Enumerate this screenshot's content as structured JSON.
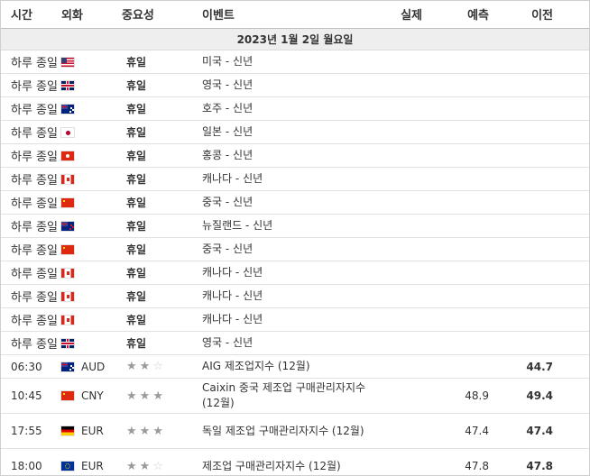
{
  "header": {
    "time": "시간",
    "currency": "외화",
    "importance": "중요성",
    "event": "이벤트",
    "actual": "실제",
    "forecast": "예측",
    "previous": "이전"
  },
  "date_row": "2023년 1월 2일 월요일",
  "holiday_rows": [
    {
      "time": "하루 종일",
      "flag": "us-flag-icon",
      "importance": "휴일",
      "event": "미국 - 신년"
    },
    {
      "time": "하루 종일",
      "flag": "gb-flag-icon",
      "importance": "휴일",
      "event": "영국 - 신년"
    },
    {
      "time": "하루 종일",
      "flag": "au-flag-icon",
      "importance": "휴일",
      "event": "호주 - 신년"
    },
    {
      "time": "하루 종일",
      "flag": "jp-flag-icon",
      "importance": "휴일",
      "event": "일본 - 신년"
    },
    {
      "time": "하루 종일",
      "flag": "hk-flag-icon",
      "importance": "휴일",
      "event": "홍콩 - 신년"
    },
    {
      "time": "하루 종일",
      "flag": "ca-flag-icon",
      "importance": "휴일",
      "event": "캐나다 - 신년"
    },
    {
      "time": "하루 종일",
      "flag": "cn-flag-icon",
      "importance": "휴일",
      "event": "중국 - 신년"
    },
    {
      "time": "하루 종일",
      "flag": "nz-flag-icon",
      "importance": "휴일",
      "event": "뉴질랜드 - 신년"
    },
    {
      "time": "하루 종일",
      "flag": "cn-flag-icon",
      "importance": "휴일",
      "event": "중국 - 신년"
    },
    {
      "time": "하루 종일",
      "flag": "ca-flag-icon",
      "importance": "휴일",
      "event": "캐나다 - 신년"
    },
    {
      "time": "하루 종일",
      "flag": "ca-flag-icon",
      "importance": "휴일",
      "event": "캐나다 - 신년"
    },
    {
      "time": "하루 종일",
      "flag": "ca-flag-icon",
      "importance": "휴일",
      "event": "캐나다 - 신년"
    },
    {
      "time": "하루 종일",
      "flag": "gb-flag-icon",
      "importance": "휴일",
      "event": "영국 - 신년"
    }
  ],
  "event_rows": [
    {
      "time": "06:30",
      "flag": "au-flag-icon",
      "currency": "AUD",
      "stars": 2,
      "event": "AIG 제조업지수 (12월)",
      "actual": "",
      "forecast": "",
      "previous": "44.7"
    },
    {
      "time": "10:45",
      "flag": "cn-flag-icon",
      "currency": "CNY",
      "stars": 3,
      "event": "Caixin 중국 제조업 구매관리자지수 (12월)",
      "actual": "",
      "forecast": "48.9",
      "previous": "49.4"
    },
    {
      "time": "17:55",
      "flag": "de-flag-icon",
      "currency": "EUR",
      "stars": 3,
      "event": "독일 제조업 구매관리자지수 (12월)",
      "actual": "",
      "forecast": "47.4",
      "previous": "47.4"
    },
    {
      "time": "18:00",
      "flag": "eu-flag-icon",
      "currency": "EUR",
      "stars": 2,
      "event": "제조업 구매관리자지수 (12월)",
      "actual": "",
      "forecast": "47.8",
      "previous": "47.8"
    }
  ],
  "star_glyphs": {
    "on": "★",
    "off": "☆"
  }
}
